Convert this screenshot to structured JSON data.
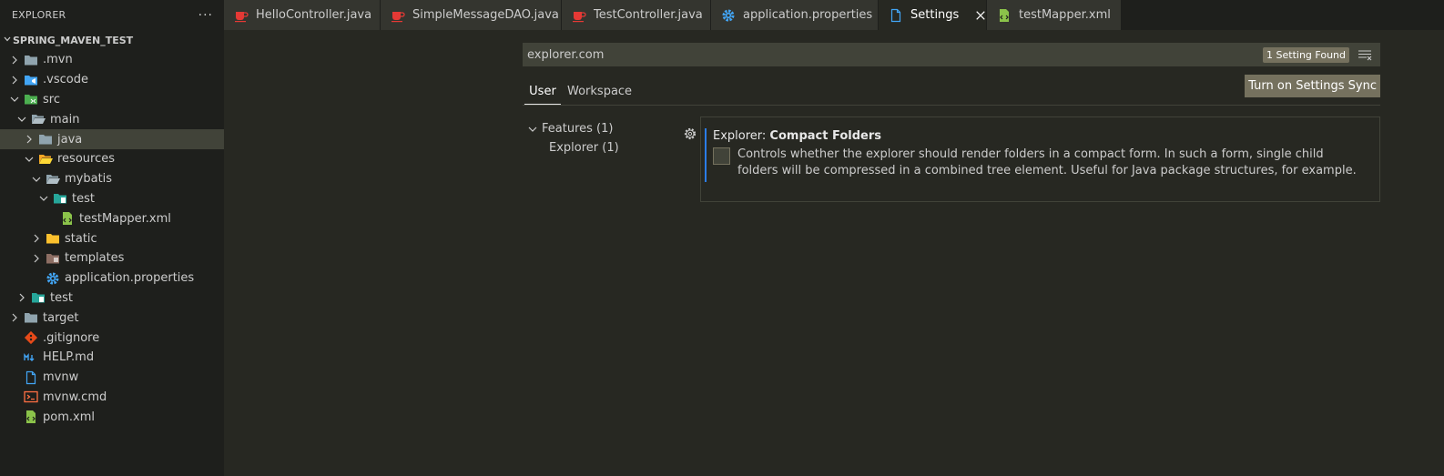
{
  "sidebar": {
    "title": "EXPLORER",
    "more": "···",
    "project": "SPRING_MAVEN_TEST",
    "items": [
      {
        "label": ".mvn",
        "icon": "folder-icon"
      },
      {
        "label": ".vscode",
        "icon": "vscode-folder-icon"
      },
      {
        "label": "src",
        "icon": "src-folder-icon"
      },
      {
        "label": "main",
        "icon": "folder-open-icon"
      },
      {
        "label": "java",
        "icon": "folder-icon"
      },
      {
        "label": "resources",
        "icon": "resources-folder-icon"
      },
      {
        "label": "mybatis",
        "icon": "folder-open-icon"
      },
      {
        "label": "test",
        "icon": "test-folder-icon"
      },
      {
        "label": "testMapper.xml",
        "icon": "xml-file-icon"
      },
      {
        "label": "static",
        "icon": "static-folder-icon"
      },
      {
        "label": "templates",
        "icon": "templates-folder-icon"
      },
      {
        "label": "application.properties",
        "icon": "gear-icon"
      },
      {
        "label": "test",
        "icon": "test-folder-icon"
      },
      {
        "label": "target",
        "icon": "folder-icon"
      },
      {
        "label": ".gitignore",
        "icon": "git-icon"
      },
      {
        "label": "HELP.md",
        "icon": "markdown-icon"
      },
      {
        "label": "mvnw",
        "icon": "file-icon"
      },
      {
        "label": "mvnw.cmd",
        "icon": "terminal-icon"
      },
      {
        "label": "pom.xml",
        "icon": "xml-file-icon"
      }
    ]
  },
  "tabs": [
    {
      "label": "HelloController.java",
      "icon": "java-icon"
    },
    {
      "label": "SimpleMessageDAO.java",
      "icon": "java-icon"
    },
    {
      "label": "TestController.java",
      "icon": "java-icon"
    },
    {
      "label": "application.properties",
      "icon": "gear-icon"
    },
    {
      "label": "Settings",
      "icon": "file-icon",
      "close": "✕"
    },
    {
      "label": "testMapper.xml",
      "icon": "xml-file-icon"
    }
  ],
  "settings": {
    "search_value": "explorer.com",
    "found": "1 Setting Found",
    "scope_user": "User",
    "scope_workspace": "Workspace",
    "sync_button": "Turn on Settings Sync",
    "toc": {
      "features": "Features (1)",
      "explorer": "Explorer (1)"
    },
    "setting": {
      "category": "Explorer: ",
      "name": "Compact Folders",
      "description": "Controls whether the explorer should render folders in a compact form. In such a form, single child folders will be compressed in a combined tree element. Useful for Java package structures, for example.",
      "checked": false
    }
  },
  "colors": {
    "accent": "#2b7de9",
    "java": "#e53935",
    "xml": "#8bc34a",
    "gear": "#42a5f5"
  }
}
